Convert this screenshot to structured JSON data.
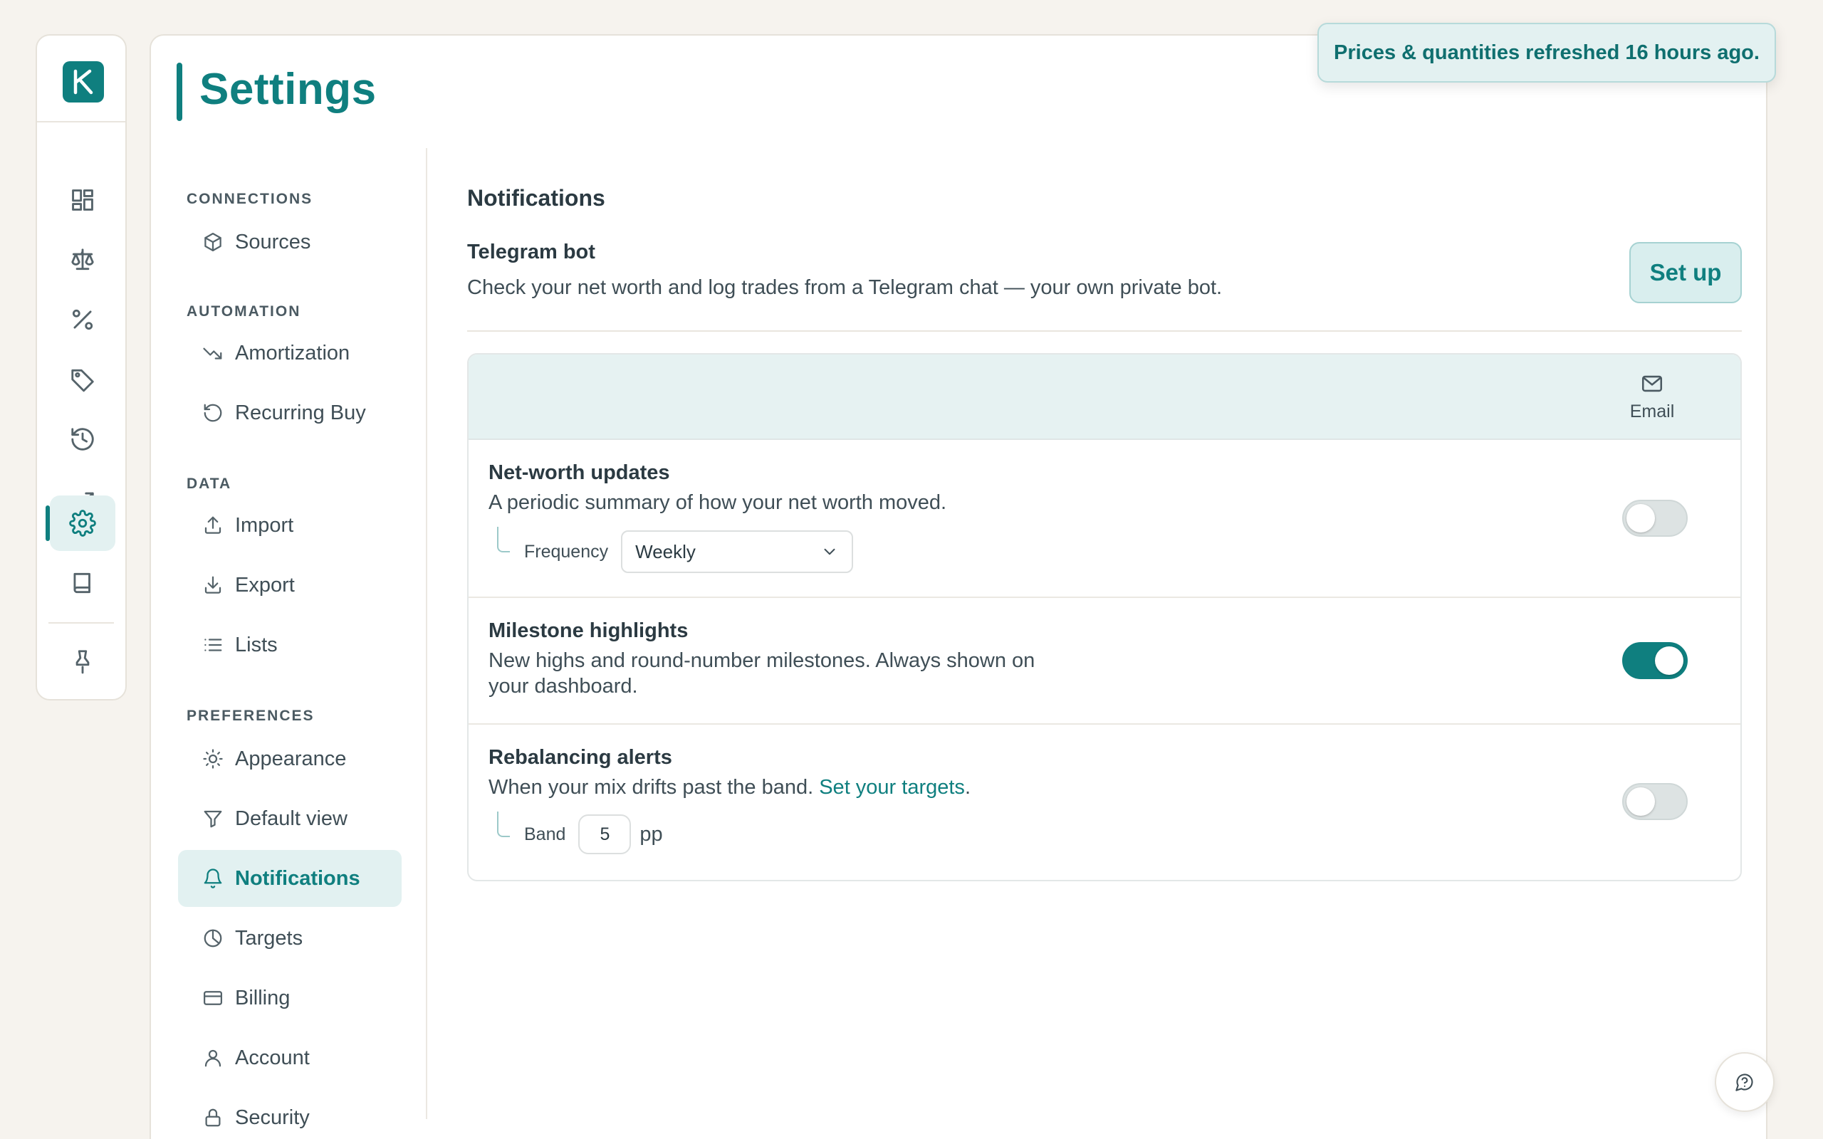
{
  "app": {
    "logo_letter": "K"
  },
  "rail": {
    "items": [
      "dashboard-icon",
      "scale-icon",
      "percent-icon",
      "tag-icon",
      "history-icon",
      "trending-up-icon",
      "gear-icon",
      "book-icon",
      "pin-icon"
    ],
    "active": "gear-icon"
  },
  "page": {
    "title": "Settings"
  },
  "nav": {
    "sections": {
      "connections": "CONNECTIONS",
      "automation": "AUTOMATION",
      "data": "DATA",
      "preferences": "PREFERENCES"
    },
    "items": {
      "sources": "Sources",
      "amortization": "Amortization",
      "recurring_buy": "Recurring Buy",
      "import": "Import",
      "export": "Export",
      "lists": "Lists",
      "appearance": "Appearance",
      "default_view": "Default view",
      "notifications": "Notifications",
      "targets": "Targets",
      "billing": "Billing",
      "account": "Account",
      "security": "Security"
    },
    "active": "notifications"
  },
  "content": {
    "title": "Notifications",
    "telegram": {
      "title": "Telegram bot",
      "description": "Check your net worth and log trades from a Telegram chat — your own private bot.",
      "button": "Set up"
    },
    "table": {
      "channel_header": "Email",
      "rows": {
        "net_worth": {
          "title": "Net-worth updates",
          "description": "A periodic summary of how your net worth moved.",
          "frequency_label": "Frequency",
          "frequency_value": "Weekly",
          "enabled": false
        },
        "milestones": {
          "title": "Milestone highlights",
          "description_1": "New highs and round-number milestones. Always shown on",
          "description_2": "your dashboard.",
          "enabled": true
        },
        "rebalancing": {
          "title": "Rebalancing alerts",
          "description": "When your mix drifts past the band.",
          "link": "Set your targets",
          "link_suffix": ".",
          "band_label": "Band",
          "band_value": "5",
          "band_unit": "pp",
          "enabled": false
        }
      }
    }
  },
  "toast": {
    "message": "Prices & quantities refreshed 16 hours ago."
  },
  "colors": {
    "accent": "#0f7f7f",
    "accent_soft": "#e2f1f1",
    "background": "#f6f3ee"
  }
}
